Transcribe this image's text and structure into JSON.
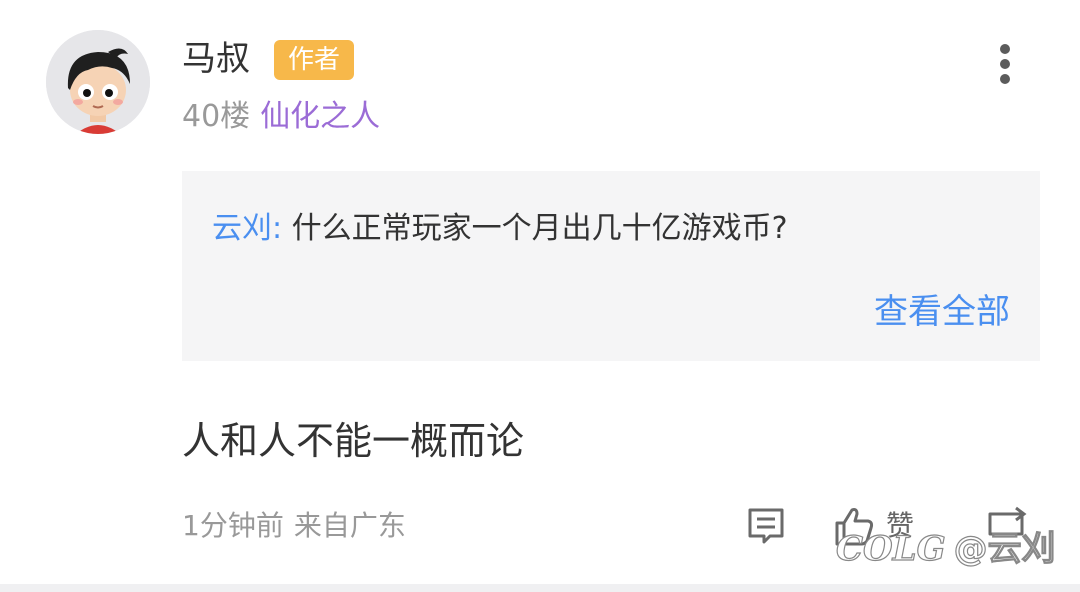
{
  "comment": {
    "author": {
      "name": "马叔",
      "badge": "作者",
      "floor": "40楼",
      "title": "仙化之人"
    },
    "quote": {
      "name": "云刈:",
      "text": "什么正常玩家一个月出几十亿游戏币?",
      "view_all": "查看全部"
    },
    "content": "人和人不能一概而论",
    "time": "1分钟前",
    "source": "来自广东",
    "actions": {
      "reply_icon": "comment-icon",
      "like_icon": "thumbs-up-icon",
      "like_label": "赞",
      "share_icon": "share-icon"
    },
    "more_icon": "more-vertical-icon"
  },
  "watermark": {
    "logo": "COLG",
    "handle": "@云刈"
  },
  "colors": {
    "badge_bg": "#f7b84a",
    "title_purple": "#9b6cd6",
    "link_blue": "#4a8ff0",
    "text_dark": "#333333",
    "text_gray": "#999999",
    "quote_bg": "#f5f5f6"
  }
}
